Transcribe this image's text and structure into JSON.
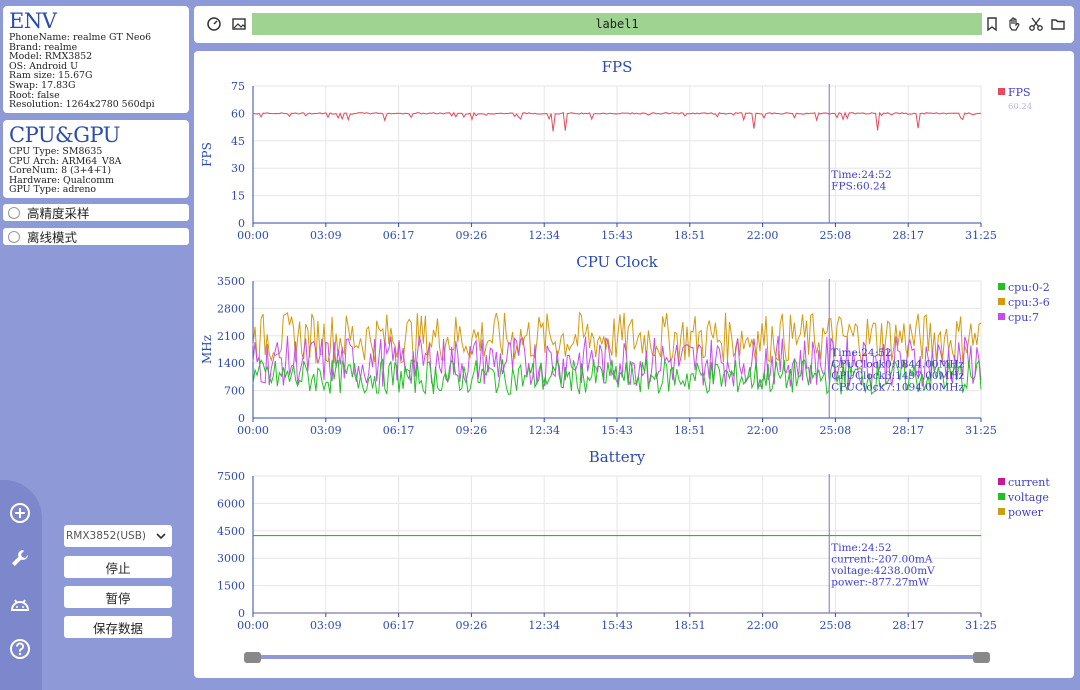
{
  "env": {
    "title": "ENV",
    "lines": [
      "PhoneName: realme GT Neo6",
      "Brand: realme",
      "Model: RMX3852",
      "OS: Android U",
      "Ram size: 15.67G",
      "Swap: 17.83G",
      "Root: false",
      "Resolution: 1264x2780 560dpi"
    ]
  },
  "cpugpu": {
    "title": "CPU&GPU",
    "lines": [
      "CPU Type: SM8635",
      "CPU Arch: ARM64_V8A",
      "CoreNum: 8 (3+4+1)",
      "Hardware: Qualcomm",
      "GPU Type: adreno"
    ]
  },
  "options": {
    "high_precision": "高精度采样",
    "offline_mode": "离线模式"
  },
  "rail": {
    "icons": [
      "add-circle-icon",
      "wrench-icon",
      "android-icon",
      "help-icon"
    ]
  },
  "controls": {
    "device": "RMX3852(USB)",
    "stop": "停止",
    "pause": "暂停",
    "save": "保存数据"
  },
  "toolbar": {
    "label": "label1",
    "left_icons": [
      "dashboard-icon",
      "image-icon"
    ],
    "right_icons": [
      "bookmark-icon",
      "hand-icon",
      "scissors-icon",
      "folder-icon"
    ]
  },
  "colors": {
    "fps": "#e8495d",
    "cpu02": "#22c022",
    "cpu36": "#d49a10",
    "cpu7": "#c84cec",
    "current": "#c8189a",
    "voltage": "#22c022",
    "power": "#c8a018",
    "cursor": "#7a70e0",
    "axis": "#2b4bb2"
  },
  "x_ticks": [
    "00:00",
    "03:09",
    "06:17",
    "09:26",
    "12:34",
    "15:43",
    "18:51",
    "22:00",
    "25:08",
    "28:17",
    "31:25"
  ],
  "chart_data": [
    {
      "type": "line",
      "title": "FPS",
      "ylabel": "FPS",
      "ylim": [
        0,
        75
      ],
      "yticks": [
        0,
        15,
        30,
        45,
        60,
        75
      ],
      "xlim_seconds": [
        0,
        1885
      ],
      "series": [
        {
          "name": "FPS",
          "baseline": 60,
          "range": [
            50,
            61
          ]
        }
      ],
      "legend": {
        "labels": [
          "FPS"
        ],
        "latest": "60.24",
        "position": "top-right"
      },
      "cursor": {
        "time": "24:52",
        "lines": [
          "Time:24:52",
          "FPS:60.24"
        ]
      }
    },
    {
      "type": "line",
      "title": "CPU Clock",
      "ylabel": "MHz",
      "ylim": [
        0,
        3500
      ],
      "yticks": [
        0,
        700,
        1400,
        2100,
        2800,
        3500
      ],
      "xlim_seconds": [
        0,
        1885
      ],
      "series": [
        {
          "name": "cpu:0-2",
          "range": [
            600,
            1500
          ]
        },
        {
          "name": "cpu:3-6",
          "range": [
            1400,
            2700
          ]
        },
        {
          "name": "cpu:7",
          "range": [
            800,
            2100
          ]
        }
      ],
      "legend": {
        "labels": [
          "cpu:0-2",
          "cpu:3-6",
          "cpu:7"
        ],
        "position": "top-right"
      },
      "cursor": {
        "time": "24:52",
        "lines": [
          "Time:24:52",
          "CPUClock0:1844.00MHz",
          "CPUClock3:1497.00MHz",
          "CPUClock7:1094.00MHz"
        ]
      }
    },
    {
      "type": "line",
      "title": "Battery",
      "ylabel": "",
      "ylim": [
        0,
        7500
      ],
      "yticks": [
        0,
        1500,
        3000,
        4500,
        6000,
        7500
      ],
      "xlim_seconds": [
        0,
        1885
      ],
      "series": [
        {
          "name": "current",
          "value": -207
        },
        {
          "name": "voltage",
          "value": 4238
        },
        {
          "name": "power",
          "value": -877.27
        }
      ],
      "legend": {
        "labels": [
          "current",
          "voltage",
          "power"
        ],
        "position": "top-right"
      },
      "cursor": {
        "time": "24:52",
        "lines": [
          "Time:24:52",
          "current:-207.00mA",
          "voltage:4238.00mV",
          "power:-877.27mW"
        ]
      }
    }
  ]
}
